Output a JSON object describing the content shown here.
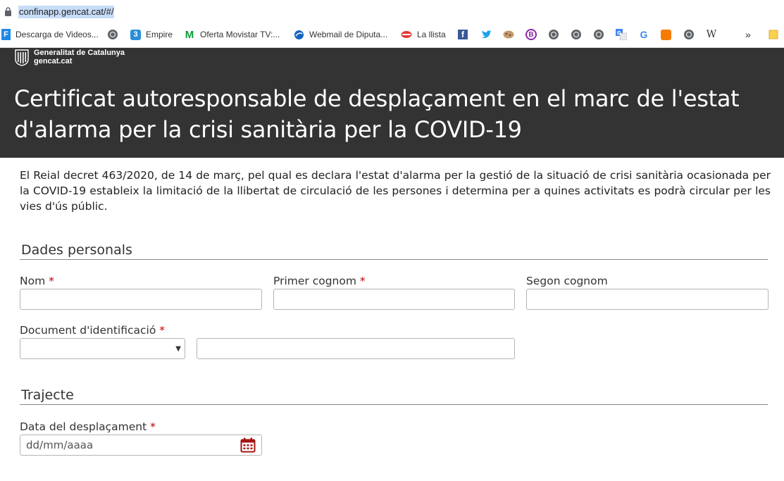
{
  "browser": {
    "url": "confinapp.gencat.cat/#/",
    "bookmarks": [
      {
        "label": "Descarga de Videos...",
        "icon": "f-bookmark-icon"
      },
      {
        "label": "Empire",
        "icon": "empire-icon"
      },
      {
        "label": "Oferta Movistar TV:...",
        "icon": "movistar-icon"
      },
      {
        "label": "Webmail de Diputa...",
        "icon": "webmail-icon"
      },
      {
        "label": "La llista",
        "icon": "lips-icon"
      }
    ],
    "overflow": "»"
  },
  "header": {
    "brand_line1": "Generalitat de Catalunya",
    "brand_line2": "gencat.cat",
    "title": "Certificat autoresponsable de desplaçament en el marc de l'estat d'alarma per la crisi sanitària per la COVID-19"
  },
  "intro": "El Reial decret 463/2020, de 14 de març, pel qual es declara l'estat d'alarma per la gestió de la situació de crisi sanitària ocasionada per la COVID-19 estableix la limitació de la llibertat de circulació de les persones i determina per a quines activitats es podrà circular per les vies d'ús públic.",
  "sections": {
    "personal": {
      "title": "Dades personals",
      "nom": "Nom",
      "primer_cognom": "Primer cognom",
      "segon_cognom": "Segon cognom",
      "document": "Document d'identificació"
    },
    "trajecte": {
      "title": "Trajecte",
      "data": "Data del desplaçament",
      "date_placeholder": "dd/mm/aaaa"
    }
  },
  "required_marker": "*",
  "colors": {
    "header_bg": "#333333",
    "required": "#c00000",
    "calendar": "#a31515"
  }
}
